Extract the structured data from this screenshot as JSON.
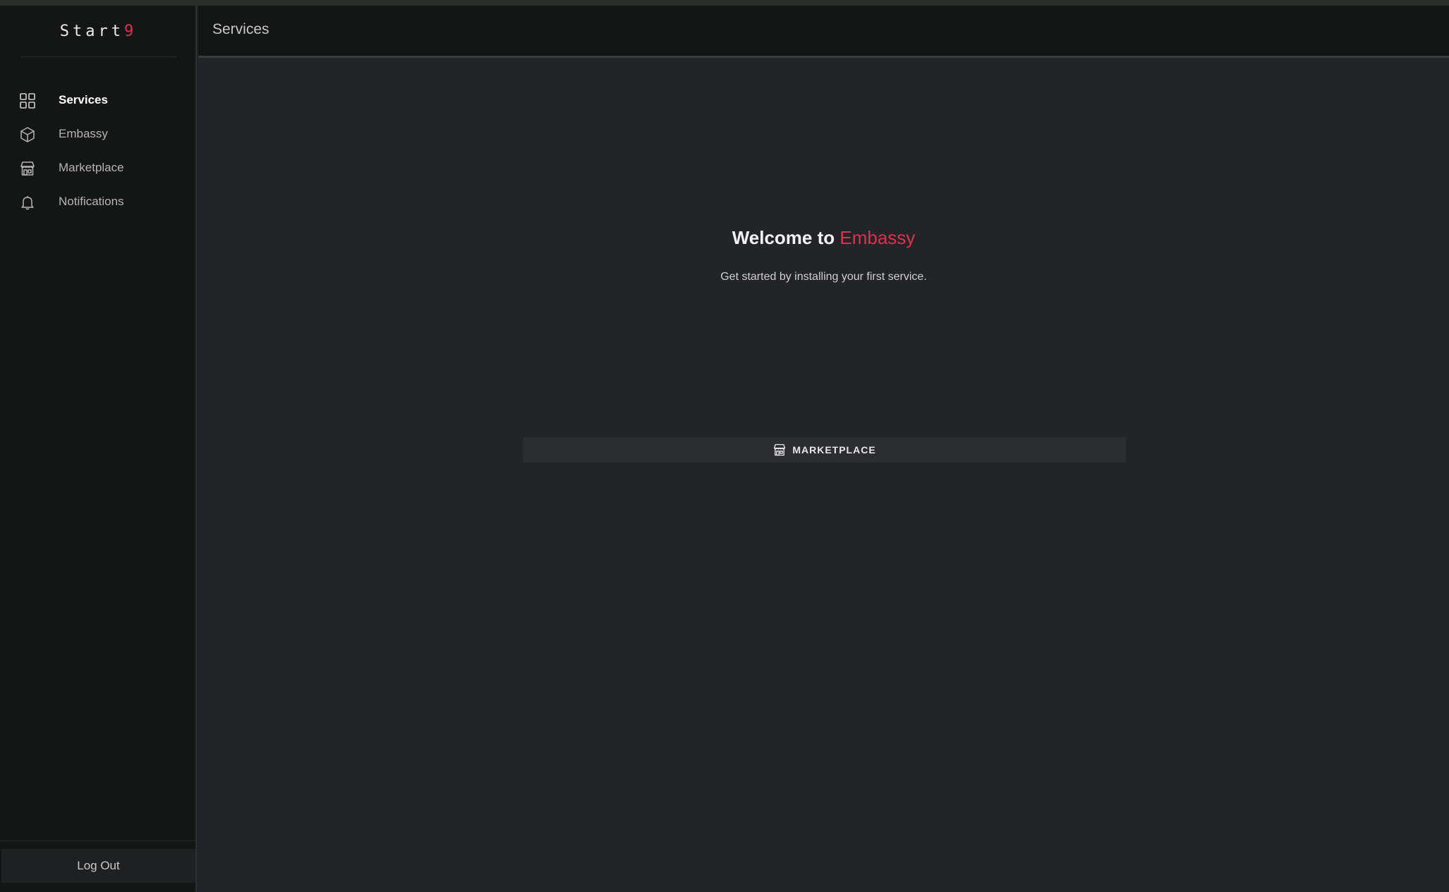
{
  "app": {
    "logo_text": "Start",
    "logo_accent": "9"
  },
  "sidebar": {
    "items": [
      {
        "label": "Services",
        "icon": "grid-icon",
        "active": true
      },
      {
        "label": "Embassy",
        "icon": "cube-icon",
        "active": false
      },
      {
        "label": "Marketplace",
        "icon": "storefront-icon",
        "active": false
      },
      {
        "label": "Notifications",
        "icon": "bell-icon",
        "active": false
      }
    ],
    "logout_label": "Log Out"
  },
  "header": {
    "title": "Services"
  },
  "main": {
    "welcome_prefix": "Welcome to",
    "welcome_brand": "Embassy",
    "subtitle": "Get started by installing your first service.",
    "marketplace_button": "MARKETPLACE"
  },
  "colors": {
    "accent": "#e0304e",
    "background": "#222428",
    "sidebar": "#141515"
  }
}
